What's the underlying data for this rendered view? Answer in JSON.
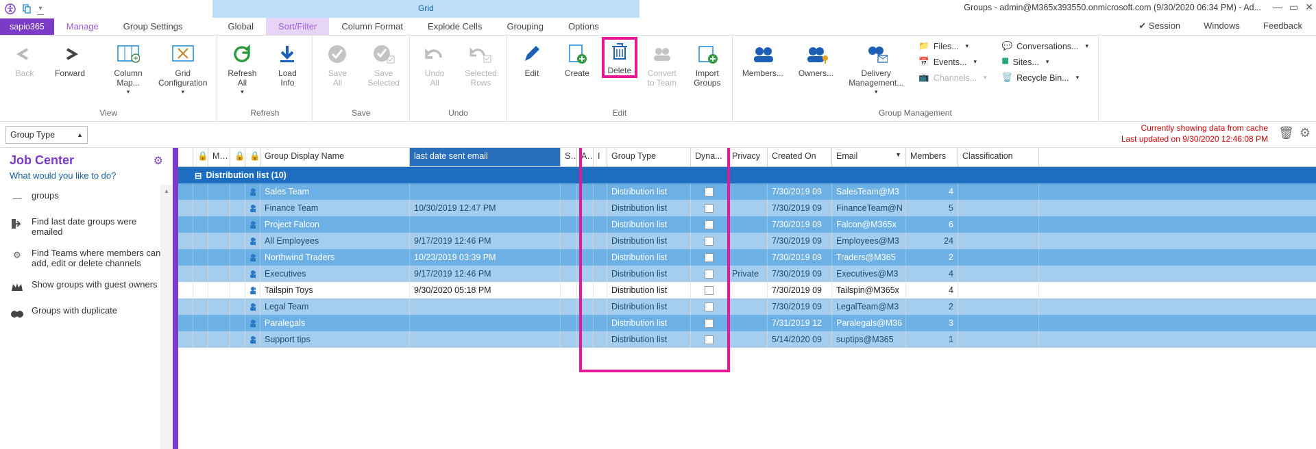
{
  "window": {
    "title": "Groups - admin@M365x393550.onmicrosoft.com (9/30/2020 06:34 PM) - Ad...",
    "grid_tab_label": "Grid"
  },
  "app_button": "sapio365",
  "tabs": [
    "Manage",
    "Group Settings",
    "Global",
    "Sort/Filter",
    "Column Format",
    "Explode Cells",
    "Grouping",
    "Options"
  ],
  "session_items": {
    "session": "Session",
    "windows": "Windows",
    "feedback": "Feedback"
  },
  "ribbon": {
    "view": {
      "title": "View",
      "back": "Back",
      "forward": "Forward",
      "colmap": "Column\nMap...",
      "gridcfg": "Grid\nConfiguration"
    },
    "refresh": {
      "title": "Refresh",
      "refresh": "Refresh\nAll",
      "load": "Load\nInfo"
    },
    "save": {
      "title": "Save",
      "all": "Save\nAll",
      "sel": "Save\nSelected"
    },
    "undo": {
      "title": "Undo",
      "all": "Undo\nAll",
      "sel": "Selected\nRows"
    },
    "edit": {
      "title": "Edit",
      "edit": "Edit",
      "create": "Create",
      "delete": "Delete",
      "conv": "Convert\nto Team",
      "import": "Import\nGroups"
    },
    "mgmt": {
      "title": "Group Management",
      "members": "Members...",
      "owners": "Owners...",
      "delivery": "Delivery\nManagement...",
      "files": "Files...",
      "events": "Events...",
      "channels": "Channels...",
      "conversations": "Conversations...",
      "sites": "Sites...",
      "recycle": "Recycle Bin..."
    }
  },
  "groupby": "Group Type",
  "cache": {
    "line1": "Currently showing data from cache",
    "line2": "Last updated on 9/30/2020 12:46:08 PM"
  },
  "jobcenter": {
    "title": "Job Center",
    "subtitle": "What would you like to do?",
    "items": [
      "groups",
      "Find last date groups were emailed",
      "Find Teams where members can add, edit or delete channels",
      "Show groups with guest owners",
      "Groups with duplicate"
    ]
  },
  "columns": {
    "m": "M...",
    "o": "",
    "display": "Group Display Name",
    "lastdate": "last date sent email",
    "s": "S...",
    "a": "A...",
    "i": "I",
    "type": "Group Type",
    "dyna": "Dyna...",
    "privacy": "Privacy",
    "created": "Created On",
    "email": "Email",
    "members": "Members",
    "classif": "Classification"
  },
  "group_header": "Distribution list (10)",
  "rows": [
    {
      "name": "Sales Team",
      "last": "",
      "type": "Distribution list",
      "privacy": "",
      "created": "7/30/2019 09",
      "email": "SalesTeam@M3",
      "members": "4",
      "sel": true
    },
    {
      "name": "Finance Team",
      "last": "10/30/2019 12:47 PM",
      "type": "Distribution list",
      "privacy": "",
      "created": "7/30/2019 09",
      "email": "FinanceTeam@N",
      "members": "5",
      "sel": true
    },
    {
      "name": "Project Falcon",
      "last": "",
      "type": "Distribution list",
      "privacy": "",
      "created": "7/30/2019 09",
      "email": "Falcon@M365x",
      "members": "6",
      "sel": true
    },
    {
      "name": "All Employees",
      "last": "9/17/2019 12:46 PM",
      "type": "Distribution list",
      "privacy": "",
      "created": "7/30/2019 09",
      "email": "Employees@M3",
      "members": "24",
      "sel": true
    },
    {
      "name": "Northwind Traders",
      "last": "10/23/2019 03:39 PM",
      "type": "Distribution list",
      "privacy": "",
      "created": "7/30/2019 09",
      "email": "Traders@M365",
      "members": "2",
      "sel": true
    },
    {
      "name": "Executives",
      "last": "9/17/2019 12:46 PM",
      "type": "Distribution list",
      "privacy": "Private",
      "created": "7/30/2019 09",
      "email": "Executives@M3",
      "members": "4",
      "sel": true
    },
    {
      "name": "Tailspin Toys",
      "last": "9/30/2020 05:18 PM",
      "type": "Distribution list",
      "privacy": "",
      "created": "7/30/2019 09",
      "email": "Tailspin@M365x",
      "members": "4",
      "sel": false
    },
    {
      "name": "Legal Team",
      "last": "",
      "type": "Distribution list",
      "privacy": "",
      "created": "7/30/2019 09",
      "email": "LegalTeam@M3",
      "members": "2",
      "sel": true
    },
    {
      "name": "Paralegals",
      "last": "",
      "type": "Distribution list",
      "privacy": "",
      "created": "7/31/2019 12",
      "email": "Paralegals@M36",
      "members": "3",
      "sel": true
    },
    {
      "name": "Support tips",
      "last": "",
      "type": "Distribution list",
      "privacy": "",
      "created": "5/14/2020 09",
      "email": "suptips@M365",
      "members": "1",
      "sel": true
    }
  ],
  "col_widths": {
    "tree": 22,
    "flag": 22,
    "m": 32,
    "o": 22,
    "ico": 22,
    "display": 218,
    "lastdate": 220,
    "s": 24,
    "a": 24,
    "i": 20,
    "type": 122,
    "dyna": 54,
    "privacy": 58,
    "created": 94,
    "email": 108,
    "members": 76,
    "classif": 118
  }
}
